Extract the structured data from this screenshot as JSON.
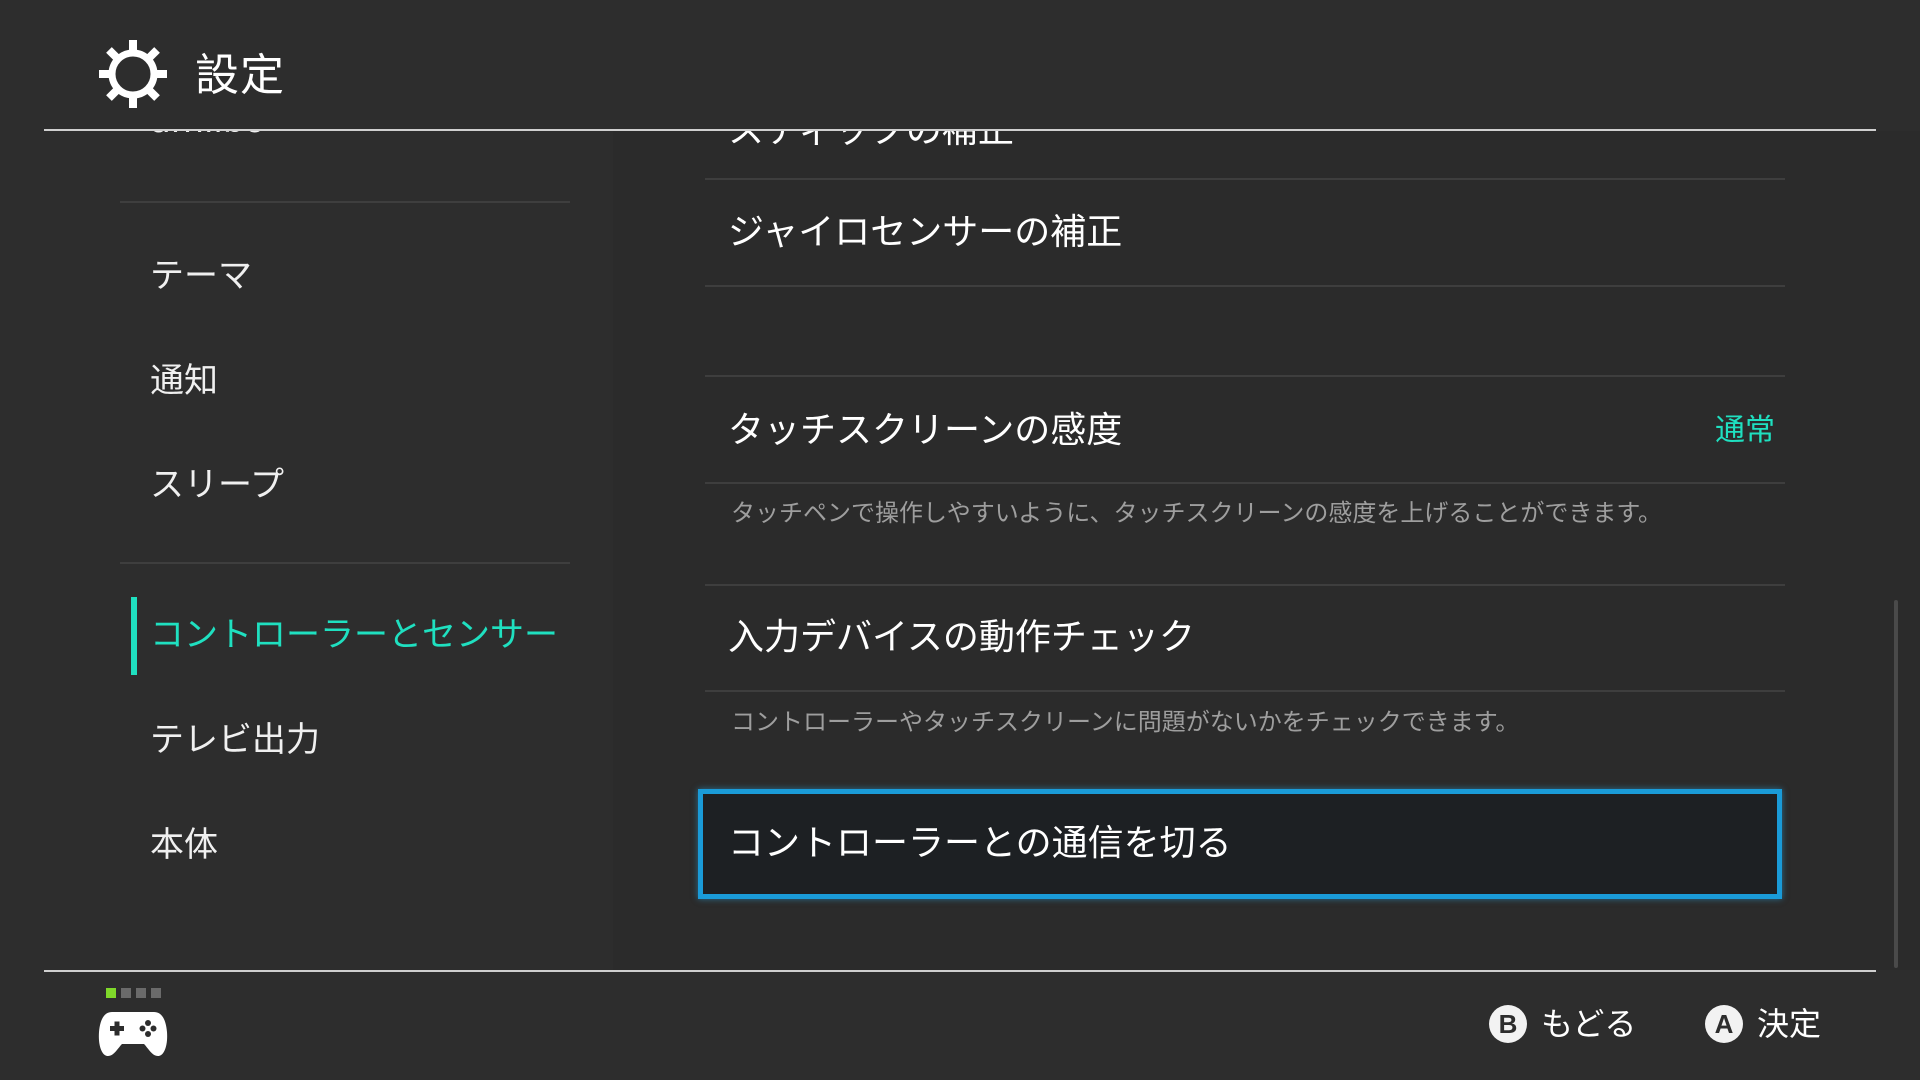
{
  "header": {
    "icon": "gear-icon",
    "title": "設定"
  },
  "sidebar": {
    "items": [
      {
        "label": "amiibo",
        "partial": true
      },
      {
        "label": "テーマ"
      },
      {
        "label": "通知"
      },
      {
        "label": "スリープ"
      },
      {
        "label": "コントローラーとセンサー",
        "selected": true
      },
      {
        "label": "テレビ出力"
      },
      {
        "label": "本体"
      }
    ]
  },
  "content": {
    "rows": [
      {
        "label": "スティックの補正",
        "partial": true
      },
      {
        "label": "ジャイロセンサーの補正"
      },
      {
        "label": "タッチスクリーンの感度",
        "value": "通常",
        "description": "タッチペンで操作しやすいように、タッチスクリーンの感度を上げることができます。"
      },
      {
        "label": "入力デバイスの動作チェック",
        "description": "コントローラーやタッチスクリーンに問題がないかをチェックできます。"
      },
      {
        "label": "コントローラーとの通信を切る",
        "focused": true
      }
    ]
  },
  "footer": {
    "controller_icon": "gamepad-icon",
    "player_indicator": {
      "active": 1,
      "total": 4
    },
    "hints": [
      {
        "button": "B",
        "label": "もどる"
      },
      {
        "button": "A",
        "label": "決定"
      }
    ]
  },
  "colors": {
    "background": "#2d2d2d",
    "accent": "#1fe0c0",
    "focus_border": "#1a9bd8",
    "player_on": "#7fd82a"
  }
}
